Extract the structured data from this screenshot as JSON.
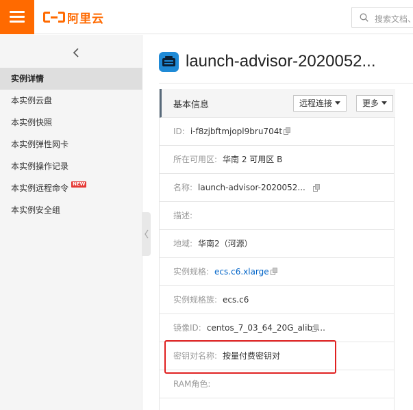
{
  "header": {
    "logo_text": "阿里云",
    "search_placeholder": "搜索文档、"
  },
  "sidebar": {
    "items": [
      {
        "label": "实例详情",
        "active": true
      },
      {
        "label": "本实例云盘"
      },
      {
        "label": "本实例快照"
      },
      {
        "label": "本实例弹性网卡"
      },
      {
        "label": "本实例操作记录"
      },
      {
        "label": "本实例远程命令",
        "badge": "NEW"
      },
      {
        "label": "本实例安全组"
      }
    ]
  },
  "main": {
    "title": "launch-advisor-2020052...",
    "panel": {
      "title": "基本信息",
      "btn_remote": "远程连接",
      "btn_more": "更多",
      "rows": [
        {
          "label": "ID:",
          "value": "i-f8zjbftmjopl9bru704t"
        },
        {
          "label": "所在可用区:",
          "value": "华南 2 可用区 B"
        },
        {
          "label": "名称:",
          "value": "launch-advisor-2020052..."
        },
        {
          "label": "描述:",
          "value": ""
        },
        {
          "label": "地域:",
          "value": "华南2（河源）"
        },
        {
          "label": "实例规格:",
          "value": "ecs.c6.xlarge"
        },
        {
          "label": "实例规格族:",
          "value": "ecs.c6"
        },
        {
          "label": "镜像ID:",
          "value": "centos_7_03_64_20G_aliba..."
        },
        {
          "label": "密钥对名称:",
          "value": "按量付费密钥对"
        },
        {
          "label": "RAM角色:",
          "value": ""
        }
      ]
    }
  },
  "colors": {
    "brand": "#ff6a00",
    "link": "#0064c8",
    "highlight": "#e02020",
    "instance_icon": "#1f8ad6"
  }
}
